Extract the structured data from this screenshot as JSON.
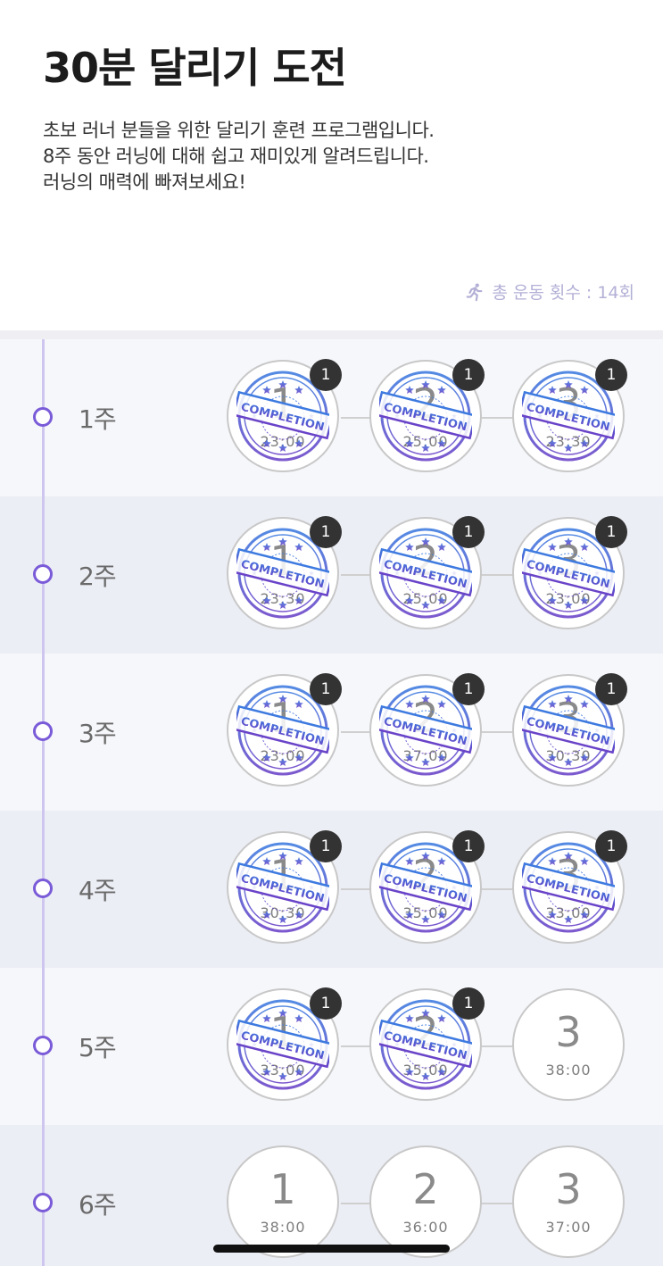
{
  "header": {
    "title": "30분 달리기 도전",
    "description": [
      "초보 러너 분들을 위한 달리기 훈련 프로그램입니다.",
      "8주 동안 러닝에 대해 쉽고 재미있게 알려드립니다.",
      "러닝의 매력에 빠져보세요!"
    ],
    "total_label": "총 운동 횟수 : 14회",
    "total_icon": "running-person-icon"
  },
  "colors": {
    "accent": "#7a5bd8",
    "timeline": "#cfc6ef",
    "row_light": "#f6f7fb",
    "row_dark": "#eceef5",
    "stamp_blue": "#3d7be0",
    "stamp_purple": "#6a43c8",
    "badge": "#333333"
  },
  "stamp_text": "COMPLETION",
  "weeks": [
    {
      "label": "1주",
      "sessions": [
        {
          "num": "1",
          "time": "23:00",
          "completed": true,
          "count": "1"
        },
        {
          "num": "2",
          "time": "25:00",
          "completed": true,
          "count": "1"
        },
        {
          "num": "3",
          "time": "23:30",
          "completed": true,
          "count": "1"
        }
      ]
    },
    {
      "label": "2주",
      "sessions": [
        {
          "num": "1",
          "time": "23:30",
          "completed": true,
          "count": "1"
        },
        {
          "num": "2",
          "time": "25:00",
          "completed": true,
          "count": "1"
        },
        {
          "num": "3",
          "time": "23:00",
          "completed": true,
          "count": "1"
        }
      ]
    },
    {
      "label": "3주",
      "sessions": [
        {
          "num": "1",
          "time": "23:00",
          "completed": true,
          "count": "1"
        },
        {
          "num": "2",
          "time": "37:00",
          "completed": true,
          "count": "1"
        },
        {
          "num": "3",
          "time": "30:30",
          "completed": true,
          "count": "1"
        }
      ]
    },
    {
      "label": "4주",
      "sessions": [
        {
          "num": "1",
          "time": "30:30",
          "completed": true,
          "count": "1"
        },
        {
          "num": "2",
          "time": "35:00",
          "completed": true,
          "count": "1"
        },
        {
          "num": "3",
          "time": "33:00",
          "completed": true,
          "count": "1"
        }
      ]
    },
    {
      "label": "5주",
      "sessions": [
        {
          "num": "1",
          "time": "33:00",
          "completed": true,
          "count": "1"
        },
        {
          "num": "2",
          "time": "35:00",
          "completed": true,
          "count": "1"
        },
        {
          "num": "3",
          "time": "38:00",
          "completed": false,
          "count": ""
        }
      ]
    },
    {
      "label": "6주",
      "sessions": [
        {
          "num": "1",
          "time": "38:00",
          "completed": false,
          "count": ""
        },
        {
          "num": "2",
          "time": "36:00",
          "completed": false,
          "count": ""
        },
        {
          "num": "3",
          "time": "37:00",
          "completed": false,
          "count": ""
        }
      ]
    }
  ]
}
